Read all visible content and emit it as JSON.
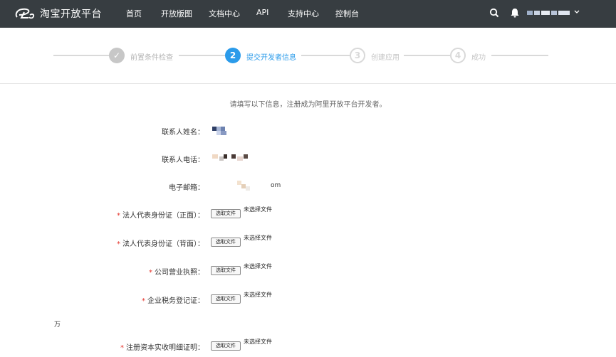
{
  "header": {
    "brand": "淘宝开放平台",
    "nav": [
      "首页",
      "开放版图",
      "文档中心",
      "API",
      "支持中心",
      "控制台"
    ],
    "icons": {
      "search": "search-icon",
      "notifications": "bell-icon",
      "account_menu": "chevron-down-icon"
    }
  },
  "steps": [
    {
      "number": "✓",
      "label": "前置条件检查",
      "state": "done"
    },
    {
      "number": "2",
      "label": "提交开发者信息",
      "state": "active"
    },
    {
      "number": "3",
      "label": "创建应用",
      "state": "todo"
    },
    {
      "number": "4",
      "label": "成功",
      "state": "todo"
    }
  ],
  "form": {
    "intro": "请填写以下信息，注册成为阿里开放平台开发者。",
    "contact_name_label": "联系人姓名：",
    "contact_phone_label": "联系人电话：",
    "email_label": "电子邮箱：",
    "email_suffix": "om",
    "id_front_label": "法人代表身份证（正面）：",
    "id_back_label": "法人代表身份证（背面）：",
    "license_label": "公司营业执照：",
    "tax_label": "企业税务登记证：",
    "capital_label": "注册资本实收明细证明：",
    "required_mark": "*",
    "file_button": "选取文件",
    "no_file": "未选择文件",
    "stray_text": "万"
  },
  "colors": {
    "topbar": "#373d41",
    "accent": "#2b9bea",
    "required": "#e5332a"
  }
}
